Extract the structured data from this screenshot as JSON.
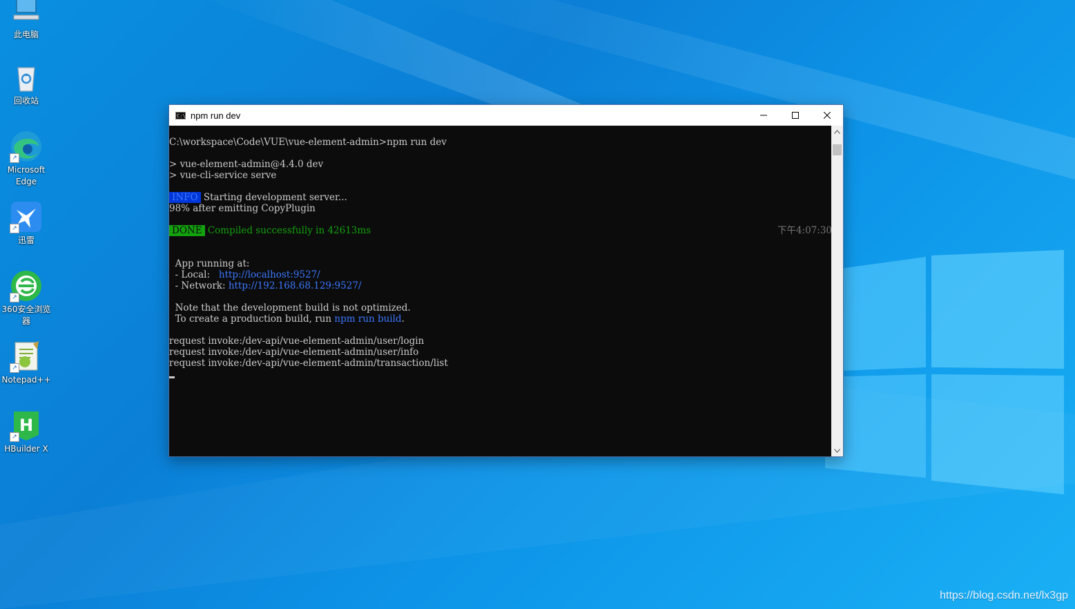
{
  "desktop": {
    "icons": [
      {
        "label": "此电脑"
      },
      {
        "label": "回收站"
      },
      {
        "label": "Microsoft Edge"
      },
      {
        "label": "迅雷"
      },
      {
        "label": "360安全浏览器"
      },
      {
        "label": "Notepad++"
      },
      {
        "label": "HBuilder X"
      }
    ],
    "watermark": "https://blog.csdn.net/lx3gp"
  },
  "window": {
    "title": "npm run dev",
    "controls": {
      "minimize": "minimize-icon",
      "maximize": "maximize-icon",
      "close": "close-icon"
    }
  },
  "terminal": {
    "prompt_line": "C:\\workspace\\Code\\VUE\\vue-element-admin>npm run dev",
    "script_line_1": "> vue-element-admin@4.4.0 dev",
    "script_line_2": "> vue-cli-service serve",
    "info_tag": "INFO",
    "info_text": " Starting development server...",
    "progress_line": "98% after emitting CopyPlugin",
    "done_tag": "DONE",
    "done_text": " Compiled successfully in 42613ms",
    "timestamp": "下午4:07:30",
    "app_running": "  App running at:",
    "local_label": "  - Local:   ",
    "local_url": "http://localhost:9527/",
    "network_label": "  - Network: ",
    "network_url": "http://192.168.68.129:9527/",
    "note_line": "  Note that the development build is not optimized.",
    "build_prefix": "  To create a production build, run ",
    "build_cmd": "npm run build",
    "build_suffix": ".",
    "requests": [
      "request invoke:/dev-api/vue-element-admin/user/login",
      "request invoke:/dev-api/vue-element-admin/user/info",
      "request invoke:/dev-api/vue-element-admin/transaction/list"
    ]
  },
  "colors": {
    "info_bg": "#0037da",
    "done_bg": "#13a10e",
    "link": "#3b78ff",
    "success": "#13a10e"
  }
}
